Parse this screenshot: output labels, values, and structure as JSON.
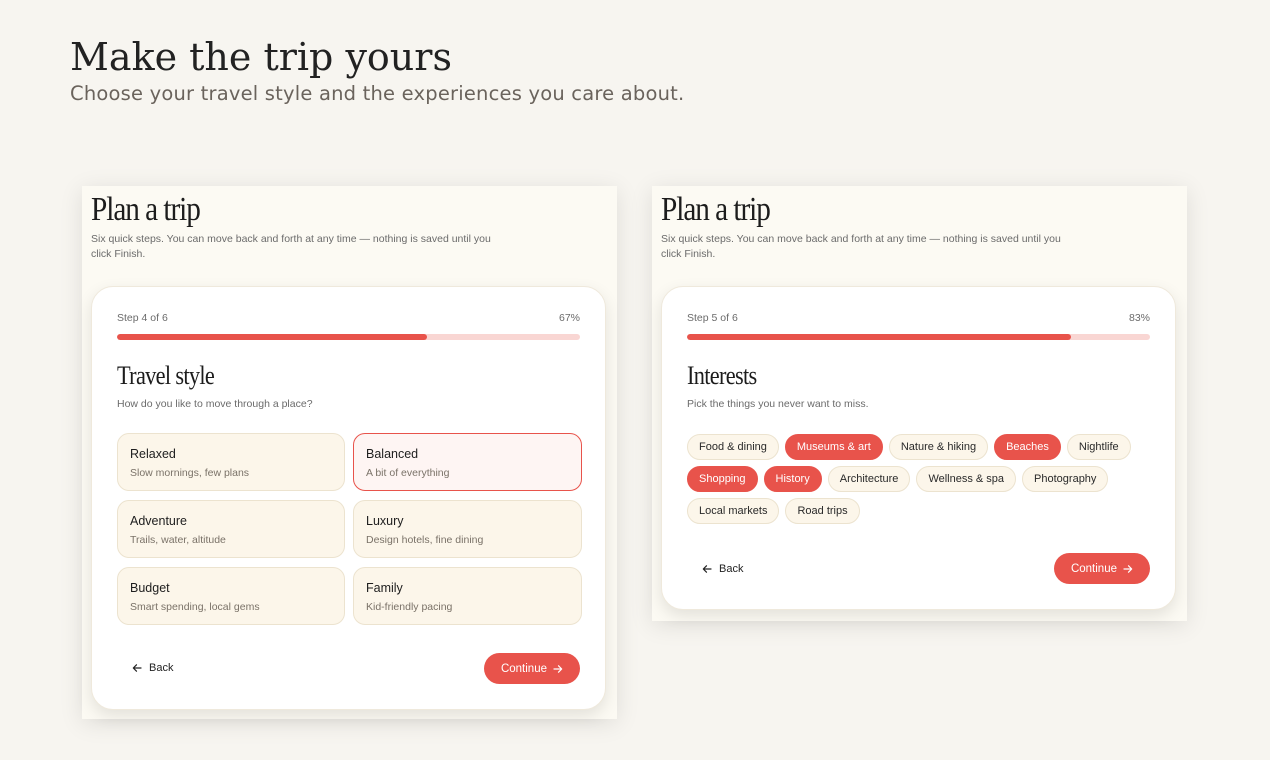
{
  "header": {
    "title": "Make the trip yours",
    "subtitle": "Choose your travel style and the experiences you care about."
  },
  "colors": {
    "accent": "#e8534b",
    "progress_track": "#f9d6d3",
    "option_bg": "#fcf6ea",
    "background": "#f7f5f0"
  },
  "left_panel": {
    "title": "Plan a trip",
    "description": "Six quick steps. You can move back and forth at any time — nothing is saved until you click Finish.",
    "step_label": "Step 4 of 6",
    "progress_percent": "67%",
    "progress_value": 0.67,
    "section_title": "Travel style",
    "section_description": "How do you like to move through a place?",
    "options": [
      {
        "name": "Relaxed",
        "description": "Slow mornings, few plans",
        "selected": false
      },
      {
        "name": "Balanced",
        "description": "A bit of everything",
        "selected": true
      },
      {
        "name": "Adventure",
        "description": "Trails, water, altitude",
        "selected": false
      },
      {
        "name": "Luxury",
        "description": "Design hotels, fine dining",
        "selected": false
      },
      {
        "name": "Budget",
        "description": "Smart spending, local gems",
        "selected": false
      },
      {
        "name": "Family",
        "description": "Kid-friendly pacing",
        "selected": false
      }
    ],
    "back_label": "Back",
    "continue_label": "Continue"
  },
  "right_panel": {
    "title": "Plan a trip",
    "description": "Six quick steps. You can move back and forth at any time — nothing is saved until you click Finish.",
    "step_label": "Step 5 of 6",
    "progress_percent": "83%",
    "progress_value": 0.83,
    "section_title": "Interests",
    "section_description": "Pick the things you never want to miss.",
    "chips": [
      {
        "label": "Food & dining",
        "selected": false
      },
      {
        "label": "Museums & art",
        "selected": true
      },
      {
        "label": "Nature & hiking",
        "selected": false
      },
      {
        "label": "Beaches",
        "selected": true
      },
      {
        "label": "Nightlife",
        "selected": false
      },
      {
        "label": "Shopping",
        "selected": true
      },
      {
        "label": "History",
        "selected": true
      },
      {
        "label": "Architecture",
        "selected": false
      },
      {
        "label": "Wellness & spa",
        "selected": false
      },
      {
        "label": "Photography",
        "selected": false
      },
      {
        "label": "Local markets",
        "selected": false
      },
      {
        "label": "Road trips",
        "selected": false
      }
    ],
    "back_label": "Back",
    "continue_label": "Continue"
  },
  "icons": {
    "back": "arrow-left-icon",
    "continue": "arrow-right-icon"
  }
}
